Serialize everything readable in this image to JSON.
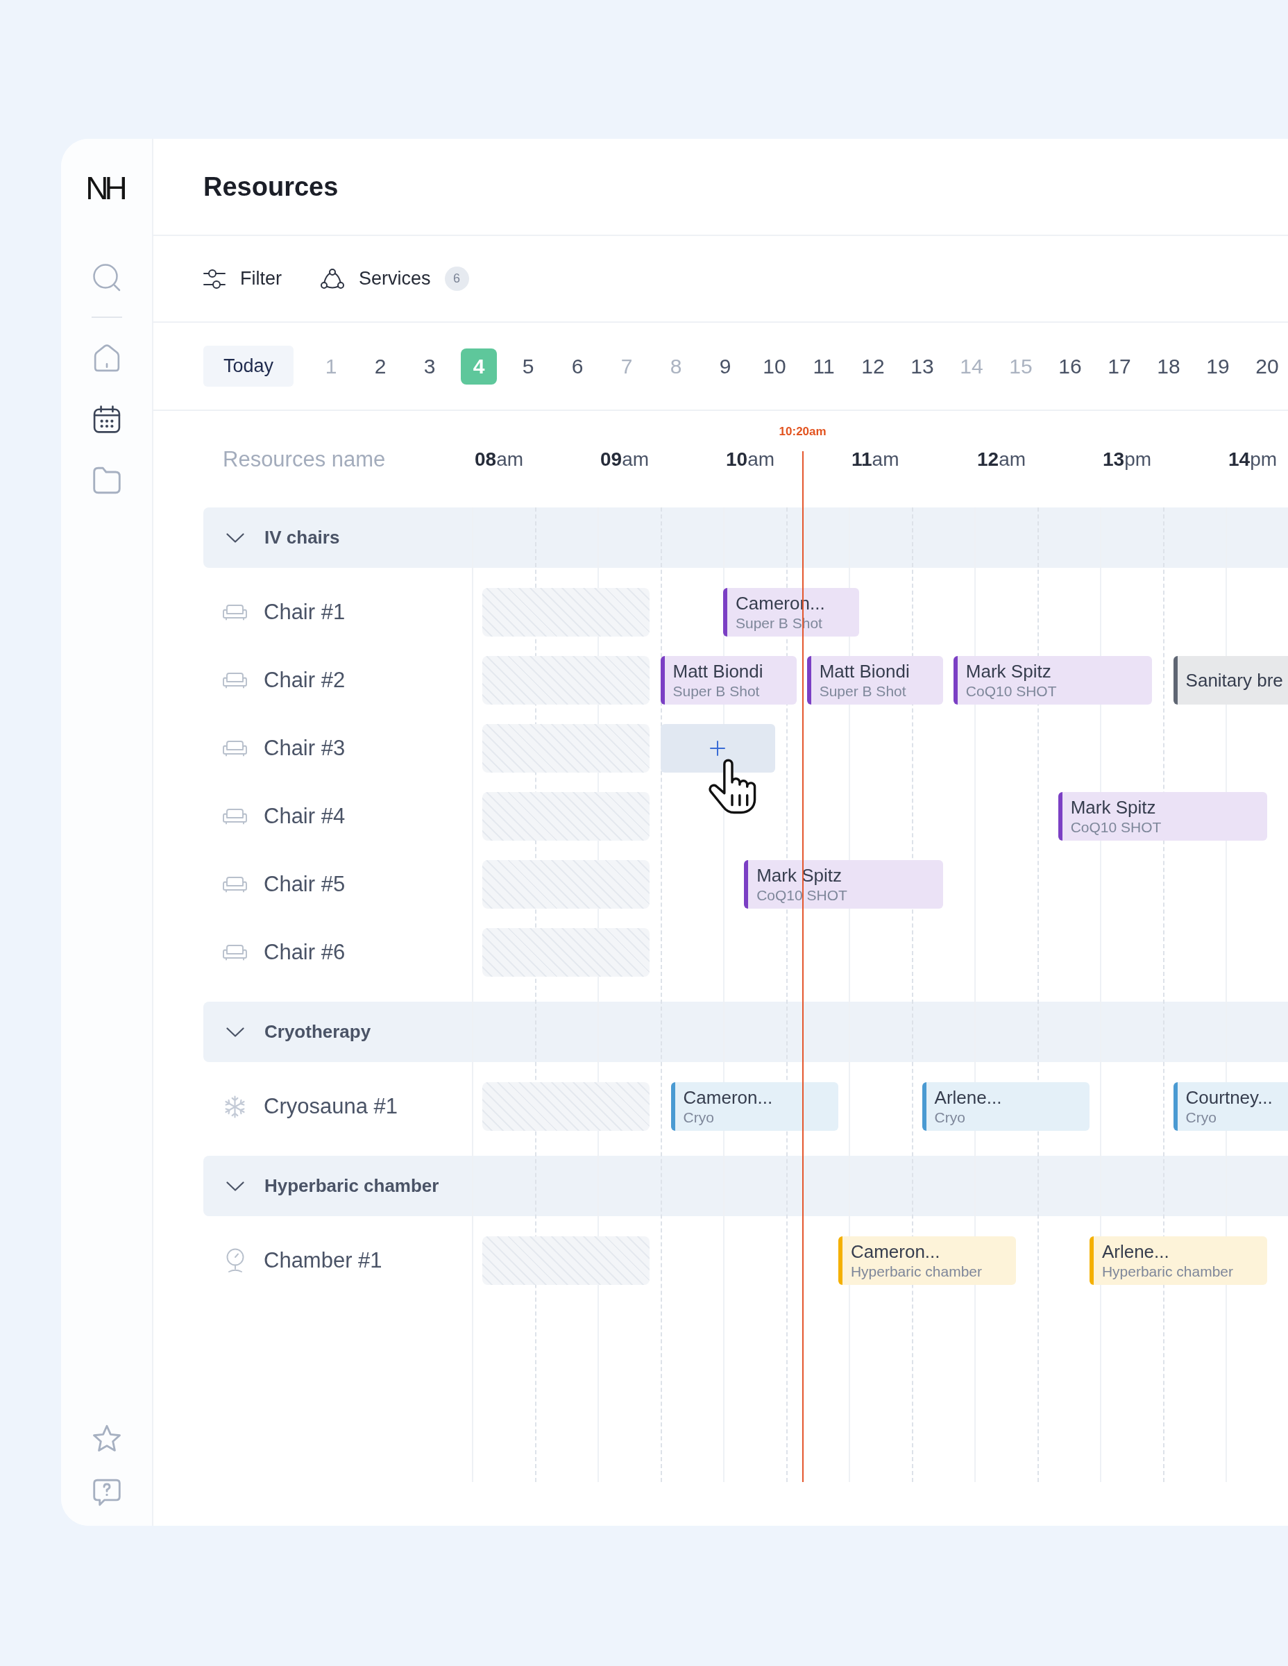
{
  "sidebar": {
    "logo": "NH",
    "top_items": [
      {
        "kind": "search",
        "selected": false
      }
    ],
    "nav_items": [
      {
        "kind": "home",
        "selected": false
      },
      {
        "kind": "calendar",
        "selected": true
      },
      {
        "kind": "folder",
        "selected": false
      }
    ],
    "bottom_items": [
      {
        "kind": "star",
        "selected": false
      },
      {
        "kind": "help",
        "selected": false
      }
    ]
  },
  "header": {
    "title": "Resources"
  },
  "toolbar": {
    "filter": {
      "label": "Filter"
    },
    "services": {
      "label": "Services",
      "count": "6"
    }
  },
  "date_strip": {
    "today": "Today",
    "days": [
      {
        "label": "1",
        "disabled": true,
        "selected": false
      },
      {
        "label": "2",
        "disabled": false,
        "selected": false
      },
      {
        "label": "3",
        "disabled": false,
        "selected": false
      },
      {
        "label": "4",
        "disabled": false,
        "selected": true
      },
      {
        "label": "5",
        "disabled": false,
        "selected": false
      },
      {
        "label": "6",
        "disabled": false,
        "selected": false
      },
      {
        "label": "7",
        "disabled": true,
        "selected": false
      },
      {
        "label": "8",
        "disabled": true,
        "selected": false
      },
      {
        "label": "9",
        "disabled": false,
        "selected": false
      },
      {
        "label": "10",
        "disabled": false,
        "selected": false
      },
      {
        "label": "11",
        "disabled": false,
        "selected": false
      },
      {
        "label": "12",
        "disabled": false,
        "selected": false
      },
      {
        "label": "13",
        "disabled": false,
        "selected": false
      },
      {
        "label": "14",
        "disabled": true,
        "selected": false
      },
      {
        "label": "15",
        "disabled": true,
        "selected": false
      },
      {
        "label": "16",
        "disabled": false,
        "selected": false
      },
      {
        "label": "17",
        "disabled": false,
        "selected": false
      },
      {
        "label": "18",
        "disabled": false,
        "selected": false
      },
      {
        "label": "19",
        "disabled": false,
        "selected": false
      },
      {
        "label": "20",
        "disabled": false,
        "selected": false
      }
    ]
  },
  "timeline": {
    "name_column": "Resources name",
    "hours": [
      "**08**am",
      "**09**am",
      "**10**am",
      "**11**am",
      "**12**am",
      "**13**pm",
      "**14**pm"
    ],
    "now": {
      "label": "10:20am"
    },
    "groups": [
      {
        "name": "IV chairs",
        "expanded": true,
        "resources": [
          {
            "name": "Chair #1",
            "kind": "chair",
            "unavailable": true,
            "events": [
              {
                "title": "Cameron...",
                "subtitle": "Super B Shot",
                "color": "#7b3fc4"
              }
            ]
          },
          {
            "name": "Chair #2",
            "kind": "chair",
            "unavailable": true,
            "events": [
              {
                "title": "Matt Biondi",
                "subtitle": "Super B Shot",
                "color": "#7b3fc4"
              },
              {
                "title": "Matt Biondi",
                "subtitle": "Super B Shot",
                "color": "#7b3fc4"
              },
              {
                "title": "Mark Spitz",
                "subtitle": "CoQ10 SHOT",
                "color": "#7b3fc4"
              },
              {
                "title": "Sanitary bre",
                "color": "#5f6673"
              }
            ]
          },
          {
            "name": "Chair #3",
            "kind": "chair",
            "unavailable": true,
            "new_slot": {
              "hovered": true
            }
          },
          {
            "name": "Chair #4",
            "kind": "chair",
            "unavailable": true,
            "events": [
              {
                "title": "Mark Spitz",
                "subtitle": "CoQ10 SHOT",
                "color": "#7b3fc4"
              }
            ]
          },
          {
            "name": "Chair #5",
            "kind": "chair",
            "unavailable": true,
            "events": [
              {
                "title": "Mark Spitz",
                "subtitle": "CoQ10 SHOT",
                "color": "#7b3fc4"
              }
            ]
          },
          {
            "name": "Chair #6",
            "kind": "chair",
            "unavailable": true
          }
        ]
      },
      {
        "name": "Cryotherapy",
        "expanded": true,
        "resources": [
          {
            "name": "Cryosauna #1",
            "kind": "cryo",
            "unavailable": true,
            "events": [
              {
                "title": "Cameron...",
                "subtitle": "Cryo",
                "color": "#4a9ad2"
              },
              {
                "title": "Arlene...",
                "subtitle": "Cryo",
                "color": "#4a9ad2"
              },
              {
                "title": "Courtney...",
                "subtitle": "Cryo",
                "color": "#4a9ad2"
              }
            ]
          }
        ]
      },
      {
        "name": "Hyperbaric chamber",
        "expanded": true,
        "resources": [
          {
            "name": "Chamber #1",
            "kind": "chamber",
            "unavailable": true,
            "events": [
              {
                "title": "Cameron...",
                "subtitle": "Hyperbaric chamber",
                "color": "#f4b000"
              },
              {
                "title": "Arlene...",
                "subtitle": "Hyperbaric chamber",
                "color": "#f4b000"
              }
            ]
          }
        ]
      }
    ]
  }
}
